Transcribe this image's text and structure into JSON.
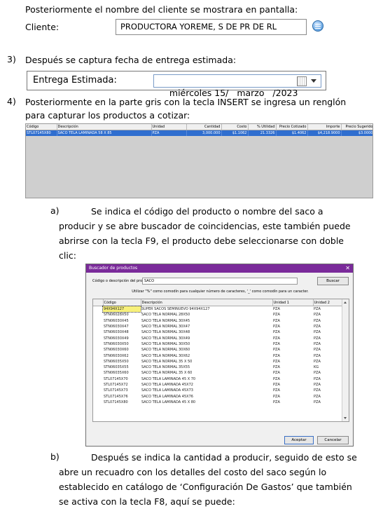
{
  "intro": {
    "line": "Posteriormente el nombre del cliente se mostrara en pantalla:"
  },
  "client": {
    "label": "Cliente:",
    "value": "PRODUCTORA YOREME, S DE PR DE RL"
  },
  "step3": {
    "num": "3)",
    "text": "Después se captura fecha de entrega estimada:"
  },
  "delivery": {
    "label": "Entrega Estimada:",
    "value": "miércoles 15/   marzo   /2023"
  },
  "step4": {
    "num": "4)",
    "line1": "Posteriormente en la parte gris con la tecla INSERT se ingresa un renglón",
    "line2": "para capturar los productos a cotizar:"
  },
  "grid": {
    "headers": [
      "Código",
      "Descripción",
      "Unidad",
      "Cantidad",
      "Costo",
      "% Utilidad",
      "Precio Cotizado",
      "Importe",
      "Precio Sugerido"
    ],
    "row": [
      "STL07145X80",
      "SACO TELA LAMINADA 58 X 85",
      "PZA",
      "3,000.000",
      "$1.1062",
      "21.3326",
      "$1.4062",
      "$4,218.9000",
      "$3.0000"
    ]
  },
  "itemA": {
    "letter": "a)",
    "line1": "Se indica el código del producto o nombre del saco a",
    "line2": "producir y se abre buscador de coincidencias, este también puede",
    "line3": "abrirse con la tecla F9, el producto debe seleccionarse con doble",
    "line4": "clic:"
  },
  "dialog": {
    "title": "Buscador de productos",
    "close": "✕",
    "search_label": "Código o descripción del producto",
    "search_value": "SACO",
    "search_button": "Buscar",
    "hint": "Utilizar \"%\" como comodín para cualquier número de caracteres, '_' como comodín para un caracter.",
    "columns": [
      "Código",
      "Descripción",
      "Unidad 1",
      "Unidad 2"
    ],
    "rows": [
      [
        "94X94X127",
        "SUPER SACOS SEMINUEVO 94X94X127",
        "PZA",
        "PZA"
      ],
      [
        "STN06028X50",
        "SACO TELA NORMAL 28X50",
        "PZA",
        "PZA"
      ],
      [
        "STN06030X45",
        "SACO TELA NORMAL 30X45",
        "PZA",
        "PZA"
      ],
      [
        "STN06030X47",
        "SACO TELA NORMAL 30X47",
        "PZA",
        "PZA"
      ],
      [
        "STN06030X48",
        "SACO TELA NORMAL 30X48",
        "PZA",
        "PZA"
      ],
      [
        "STN06030X49",
        "SACO TELA NORMAL 30X49",
        "PZA",
        "PZA"
      ],
      [
        "STN06030X50",
        "SACO TELA NORMAL 30X50",
        "PZA",
        "PZA"
      ],
      [
        "STN06030X60",
        "SACO TELA NORMAL 30X60",
        "PZA",
        "PZA"
      ],
      [
        "STN06030X62",
        "SACO TELA NORMAL 30X62",
        "PZA",
        "PZA"
      ],
      [
        "STN06035X50",
        "SACO TELA NORMAL 35 X 50",
        "PZA",
        "PZA"
      ],
      [
        "STN06035X55",
        "SACO TELA NORMAL 35X55",
        "PZA",
        "KG"
      ],
      [
        "STN06035X60",
        "SACO TELA NORMAL 35 X 60",
        "PZA",
        "PZA"
      ],
      [
        "STL07145X70",
        "SACO TELA LAMINADA 45 X 70",
        "PZA",
        "PZA"
      ],
      [
        "STL07145X72",
        "SACO TELA LAMINADA 45X72",
        "PZA",
        "PZA"
      ],
      [
        "STL07145X73",
        "SACO TELA LAMINADA 45X73",
        "PZA",
        "PZA"
      ],
      [
        "STL07145X76",
        "SACO TELA LAMINADA 45X76",
        "PZA",
        "PZA"
      ],
      [
        "STL07145X80",
        "SACO TELA LAMINADA 45 X 80",
        "PZA",
        "PZA"
      ]
    ],
    "accept": "Aceptar",
    "cancel": "Cancelar"
  },
  "itemB": {
    "letter": "b)",
    "line1": "Después se indica la cantidad a producir, seguido de esto se",
    "line2": "abre un recuadro con los detalles del costo del saco según lo",
    "line3": "establecido en catálogo de ‘Configuración De Gastos’ que también",
    "line4": "se activa con la tecla F8, aquí se puede:"
  }
}
